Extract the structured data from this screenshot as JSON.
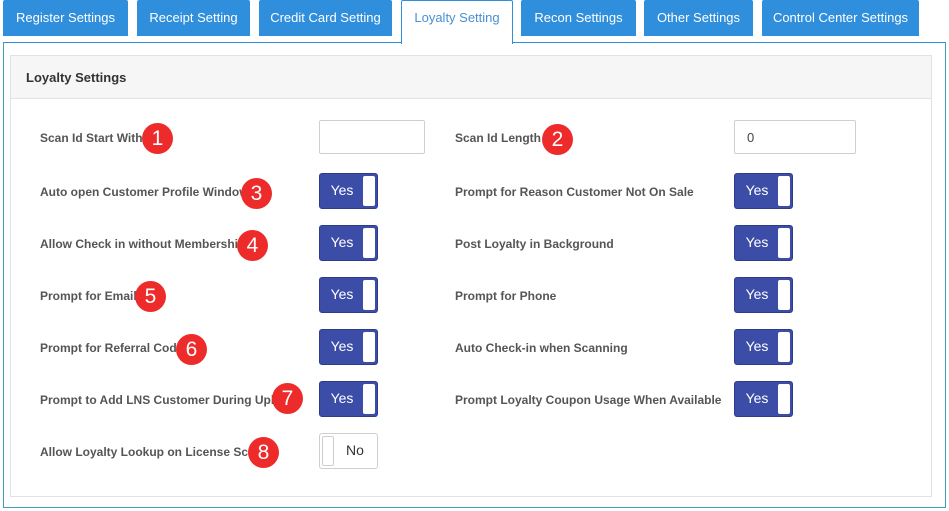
{
  "tabs": [
    {
      "label": "Register Settings",
      "active": false
    },
    {
      "label": "Receipt Setting",
      "active": false
    },
    {
      "label": "Credit Card Setting",
      "active": false
    },
    {
      "label": "Loyalty Setting",
      "active": true
    },
    {
      "label": "Recon Settings",
      "active": false
    },
    {
      "label": "Other Settings",
      "active": false
    },
    {
      "label": "Control Center Settings",
      "active": false
    }
  ],
  "panel": {
    "title": "Loyalty Settings"
  },
  "left": {
    "scan_id_start": {
      "label": "Scan Id Start With",
      "value": "",
      "badge": "1"
    },
    "auto_open_profile": {
      "label": "Auto open Customer Profile Window",
      "value": "Yes",
      "badge": "3"
    },
    "allow_checkin": {
      "label": "Allow Check in without Membership",
      "value": "Yes",
      "badge": "4"
    },
    "prompt_email": {
      "label": "Prompt for Email",
      "value": "Yes",
      "badge": "5"
    },
    "prompt_referral": {
      "label": "Prompt for Referral Code",
      "value": "Yes",
      "badge": "6"
    },
    "prompt_lns": {
      "label": "Prompt to Add LNS Customer During Uplift",
      "value": "Yes",
      "badge": "7"
    },
    "allow_lookup": {
      "label": "Allow Loyalty Lookup on License Scan",
      "value": "No",
      "badge": "8"
    }
  },
  "right": {
    "scan_id_length": {
      "label": "Scan Id Length",
      "value": "0",
      "badge": "2"
    },
    "prompt_reason": {
      "label": "Prompt for Reason Customer Not On Sale",
      "value": "Yes"
    },
    "post_background": {
      "label": "Post Loyalty in Background",
      "value": "Yes"
    },
    "prompt_phone": {
      "label": "Prompt for Phone",
      "value": "Yes"
    },
    "auto_checkin_scan": {
      "label": "Auto Check-in when Scanning",
      "value": "Yes"
    },
    "prompt_coupon": {
      "label": "Prompt Loyalty Coupon Usage When Available",
      "value": "Yes"
    }
  },
  "colors": {
    "tab_blue": "#2f8fdc",
    "toggle_on": "#3c4da8",
    "badge_red": "#ee2b2b"
  }
}
